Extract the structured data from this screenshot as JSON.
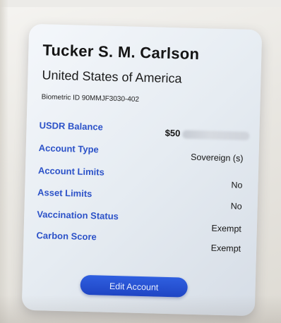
{
  "profile": {
    "name": "Tucker S. M. Carlson",
    "country": "United States of America",
    "biometric_id": "Biometric ID 90MMJF3030-402"
  },
  "rows": [
    {
      "label": "USDR Balance",
      "value": "$50"
    },
    {
      "label": "Account Type",
      "value": "Sovereign (s)"
    },
    {
      "label": "Account Limits",
      "value": "No"
    },
    {
      "label": "Asset Limits",
      "value": "No"
    },
    {
      "label": "Vaccination Status",
      "value": "Exempt"
    },
    {
      "label": "Carbon Score",
      "value": "Exempt"
    }
  ],
  "actions": {
    "edit_label": "Edit Account"
  },
  "colors": {
    "label_blue": "#2c52c8",
    "button_blue": "#1f45c4",
    "card_bg": "#e6ecf2"
  }
}
